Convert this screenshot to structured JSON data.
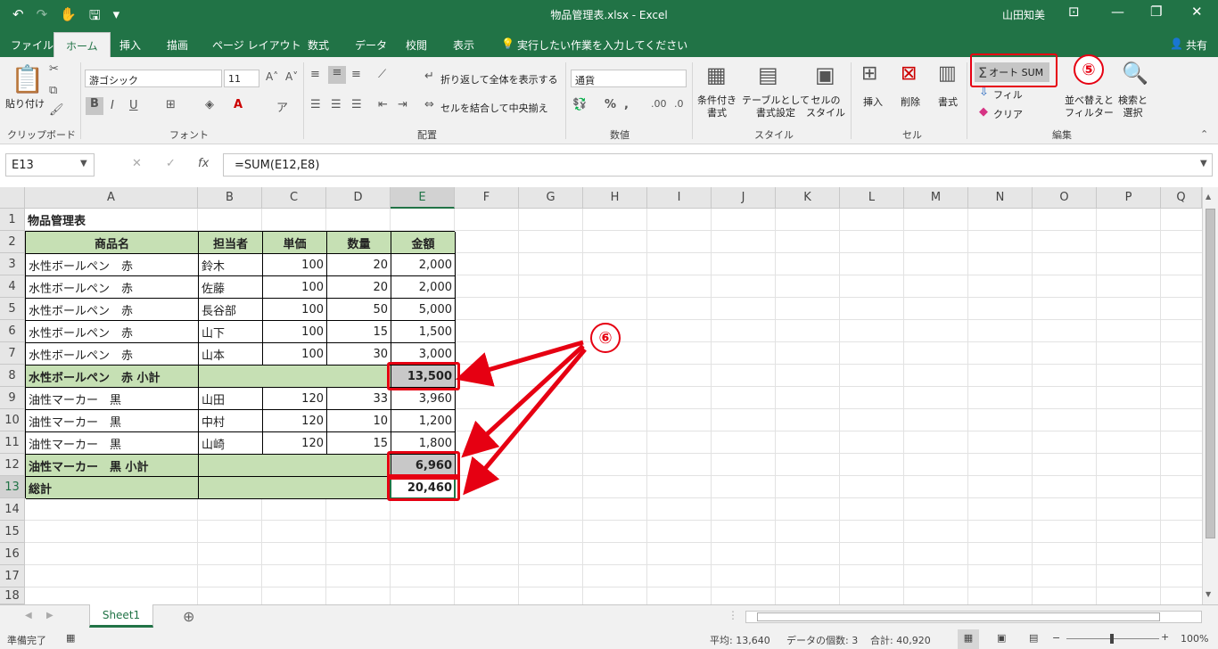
{
  "titlebar": {
    "title": "物品管理表.xlsx  -  Excel",
    "user": "山田知美"
  },
  "tabs": [
    "ファイル",
    "ホーム",
    "挿入",
    "描画",
    "ページ レイアウト",
    "数式",
    "データ",
    "校閲",
    "表示"
  ],
  "tellme": "実行したい作業を入力してください",
  "share": "共有",
  "ribbon": {
    "paste": "貼り付け",
    "clipboard": "クリップボード",
    "font_name": "游ゴシック",
    "font_size": "11",
    "font": "フォント",
    "wrap": "折り返して全体を表示する",
    "merge": "セルを結合して中央揃え",
    "alignment": "配置",
    "number_format": "通貨",
    "number": "数値",
    "cond": "条件付き\n書式",
    "table": "テーブルとして\n書式設定",
    "cellstyle": "セルの\nスタイル",
    "styles": "スタイル",
    "insert": "挿入",
    "delete": "削除",
    "format": "書式",
    "cells": "セル",
    "autosum": "オート SUM",
    "fill": "フィル",
    "clear": "クリア",
    "sort": "並べ替えと\nフィルター",
    "find": "検索と\n選択",
    "editing": "編集"
  },
  "formula_bar": {
    "namebox": "E13",
    "formula": "=SUM(E12,E8)"
  },
  "columns": [
    "A",
    "B",
    "C",
    "D",
    "E",
    "F",
    "G",
    "H",
    "I",
    "J",
    "K",
    "L",
    "M",
    "N",
    "O",
    "P",
    "Q"
  ],
  "rows": [
    "1",
    "2",
    "3",
    "4",
    "5",
    "6",
    "7",
    "8",
    "9",
    "10",
    "11",
    "12",
    "13",
    "14",
    "15",
    "16",
    "17",
    "18"
  ],
  "sheet": {
    "title": "物品管理表",
    "headers": [
      "商品名",
      "担当者",
      "単価",
      "数量",
      "金額"
    ],
    "data": [
      [
        "水性ボールペン　赤",
        "鈴木",
        "100",
        "20",
        "2,000"
      ],
      [
        "水性ボールペン　赤",
        "佐藤",
        "100",
        "20",
        "2,000"
      ],
      [
        "水性ボールペン　赤",
        "長谷部",
        "100",
        "50",
        "5,000"
      ],
      [
        "水性ボールペン　赤",
        "山下",
        "100",
        "15",
        "1,500"
      ],
      [
        "水性ボールペン　赤",
        "山本",
        "100",
        "30",
        "3,000"
      ],
      [
        "水性ボールペン　赤 小計",
        "",
        "",
        "",
        "13,500"
      ],
      [
        "油性マーカー　黒",
        "山田",
        "120",
        "33",
        "3,960"
      ],
      [
        "油性マーカー　黒",
        "中村",
        "120",
        "10",
        "1,200"
      ],
      [
        "油性マーカー　黒",
        "山崎",
        "120",
        "15",
        "1,800"
      ],
      [
        "油性マーカー　黒 小計",
        "",
        "",
        "",
        "6,960"
      ],
      [
        "総計",
        "",
        "",
        "",
        "20,460"
      ]
    ]
  },
  "annotations": {
    "step5": "⑤",
    "step6": "⑥",
    "accent": "#e60012"
  },
  "sheet_tab": "Sheet1",
  "status": {
    "ready": "準備完了",
    "average": "平均: 13,640",
    "count": "データの個数: 3",
    "sum": "合計: 40,920",
    "zoom": "100%"
  }
}
